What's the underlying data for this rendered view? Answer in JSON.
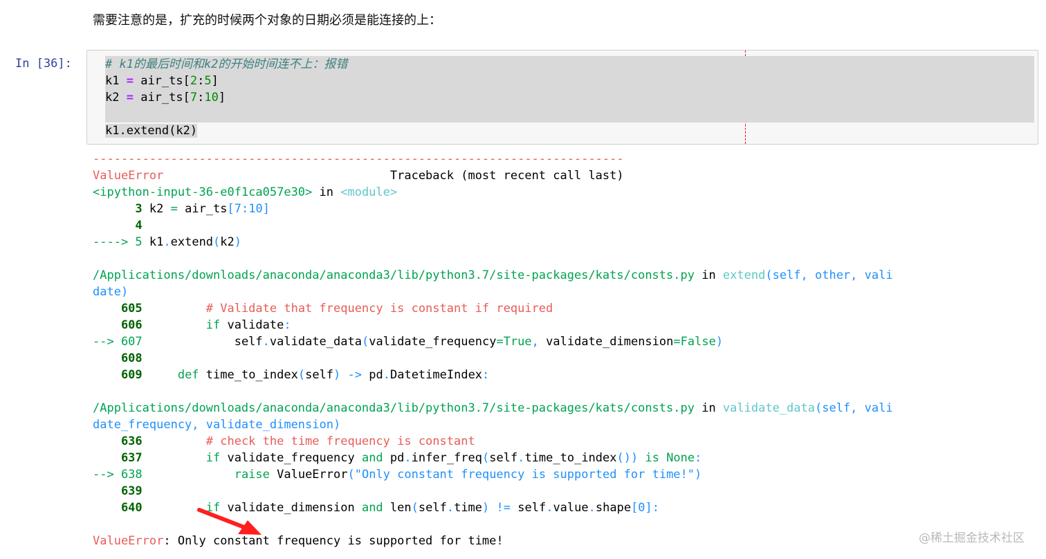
{
  "markdown": {
    "text": "需要注意的是，扩充的时候两个对象的日期必须是能连接的上："
  },
  "cell": {
    "prompt": "In [36]:",
    "code": {
      "comment": "# k1的最后时间和k2的开始时间连不上：报错",
      "line2_a": "k1 ",
      "line2_op": "=",
      "line2_b": " air_ts[",
      "line2_n1": "2",
      "line2_c": ":",
      "line2_n2": "5",
      "line2_d": "]",
      "line3_a": "k2 ",
      "line3_op": "=",
      "line3_b": " air_ts[",
      "line3_n1": "7",
      "line3_c": ":",
      "line3_n2": "10",
      "line3_d": "]",
      "line5": "k1.extend(k2)"
    }
  },
  "traceback": {
    "dashes": "---------------------------------------------------------------------------",
    "error_name": "ValueError",
    "header_right": "                                Traceback (most recent call last)",
    "input_ref": "<ipython-input-36-e0f1ca057e30>",
    "in_word": " in ",
    "module": "<module>",
    "f1": {
      "l3_no": "      3",
      "l3_code_a": " k2 ",
      "l3_eq": "=",
      "l3_code_b": " air_ts",
      "l3_br": "[7:10]",
      "l4_no": "      4",
      "l5_arrow": "----> 5",
      "l5_a": " k1",
      "l5_dot": ".",
      "l5_b": "extend",
      "l5_p1": "(",
      "l5_c": "k2",
      "l5_p2": ")"
    },
    "f2": {
      "path": "/Applications/downloads/anaconda/anaconda3/lib/python3.7/site-packages/kats/consts.py",
      "in_word": " in ",
      "func": "extend",
      "args_a": "(self, other, vali",
      "args_b": "date)",
      "l605_no": "    605",
      "l605_code": "         # Validate that frequency is constant if required",
      "l606_no": "    606",
      "l606_kw": "         if",
      "l606_code": " validate",
      "l606_colon": ":",
      "l607_no": "--> 607",
      "l607_a": "             self",
      "l607_dot": ".",
      "l607_b": "validate_data",
      "l607_p1": "(",
      "l607_c": "validate_frequency",
      "l607_eq": "=",
      "l607_true": "True",
      "l607_comma": ",",
      "l607_d": " validate_dimension",
      "l607_eq2": "=",
      "l607_false": "False",
      "l607_p2": ")",
      "l608_no": "    608",
      "l609_no": "    609",
      "l609_kw": "     def",
      "l609_a": " time_to_index",
      "l609_p1": "(",
      "l609_self": "self",
      "l609_p2": ")",
      "l609_arrow": " ->",
      "l609_b": " pd",
      "l609_dot": ".",
      "l609_c": "DatetimeIndex",
      "l609_colon": ":"
    },
    "f3": {
      "path": "/Applications/downloads/anaconda/anaconda3/lib/python3.7/site-packages/kats/consts.py",
      "in_word": " in ",
      "func": "validate_data",
      "args_a": "(self, vali",
      "args_b": "date_frequency, validate_dimension)",
      "l636_no": "    636",
      "l636_code": "         # check the time frequency is constant",
      "l637_no": "    637",
      "l637_kw": "         if",
      "l637_a": " validate_frequency ",
      "l637_and": "and",
      "l637_b": " pd",
      "l637_dot": ".",
      "l637_c": "infer_freq",
      "l637_p1": "(",
      "l637_self": "self",
      "l637_dot2": ".",
      "l637_d": "time_to_index",
      "l637_p2": "())",
      "l637_is": " is",
      "l637_none": " None",
      "l637_colon": ":",
      "l638_no": "--> 638",
      "l638_kw": "             raise",
      "l638_a": " ValueError",
      "l638_p1": "(",
      "l638_str": "\"Only constant frequency is supported for time!\"",
      "l638_p2": ")",
      "l639_no": "    639",
      "l640_no": "    640",
      "l640_kw": "         if",
      "l640_a": " validate_dimension ",
      "l640_and": "and",
      "l640_b": " len",
      "l640_p1": "(",
      "l640_self": "self",
      "l640_dot": ".",
      "l640_c": "time",
      "l640_p2": ")",
      "l640_ne": " !=",
      "l640_d": " self",
      "l640_dot2": ".",
      "l640_e": "value",
      "l640_dot3": ".",
      "l640_f": "shape",
      "l640_br": "[0]:"
    },
    "final_name": "ValueError",
    "final_msg": ": Only constant frequency is supported for time!"
  },
  "annotation": {
    "arrow_icon": "red-arrow-icon",
    "color": "#ff1f1f"
  },
  "watermark": {
    "text": "@稀土掘金技术社区"
  }
}
